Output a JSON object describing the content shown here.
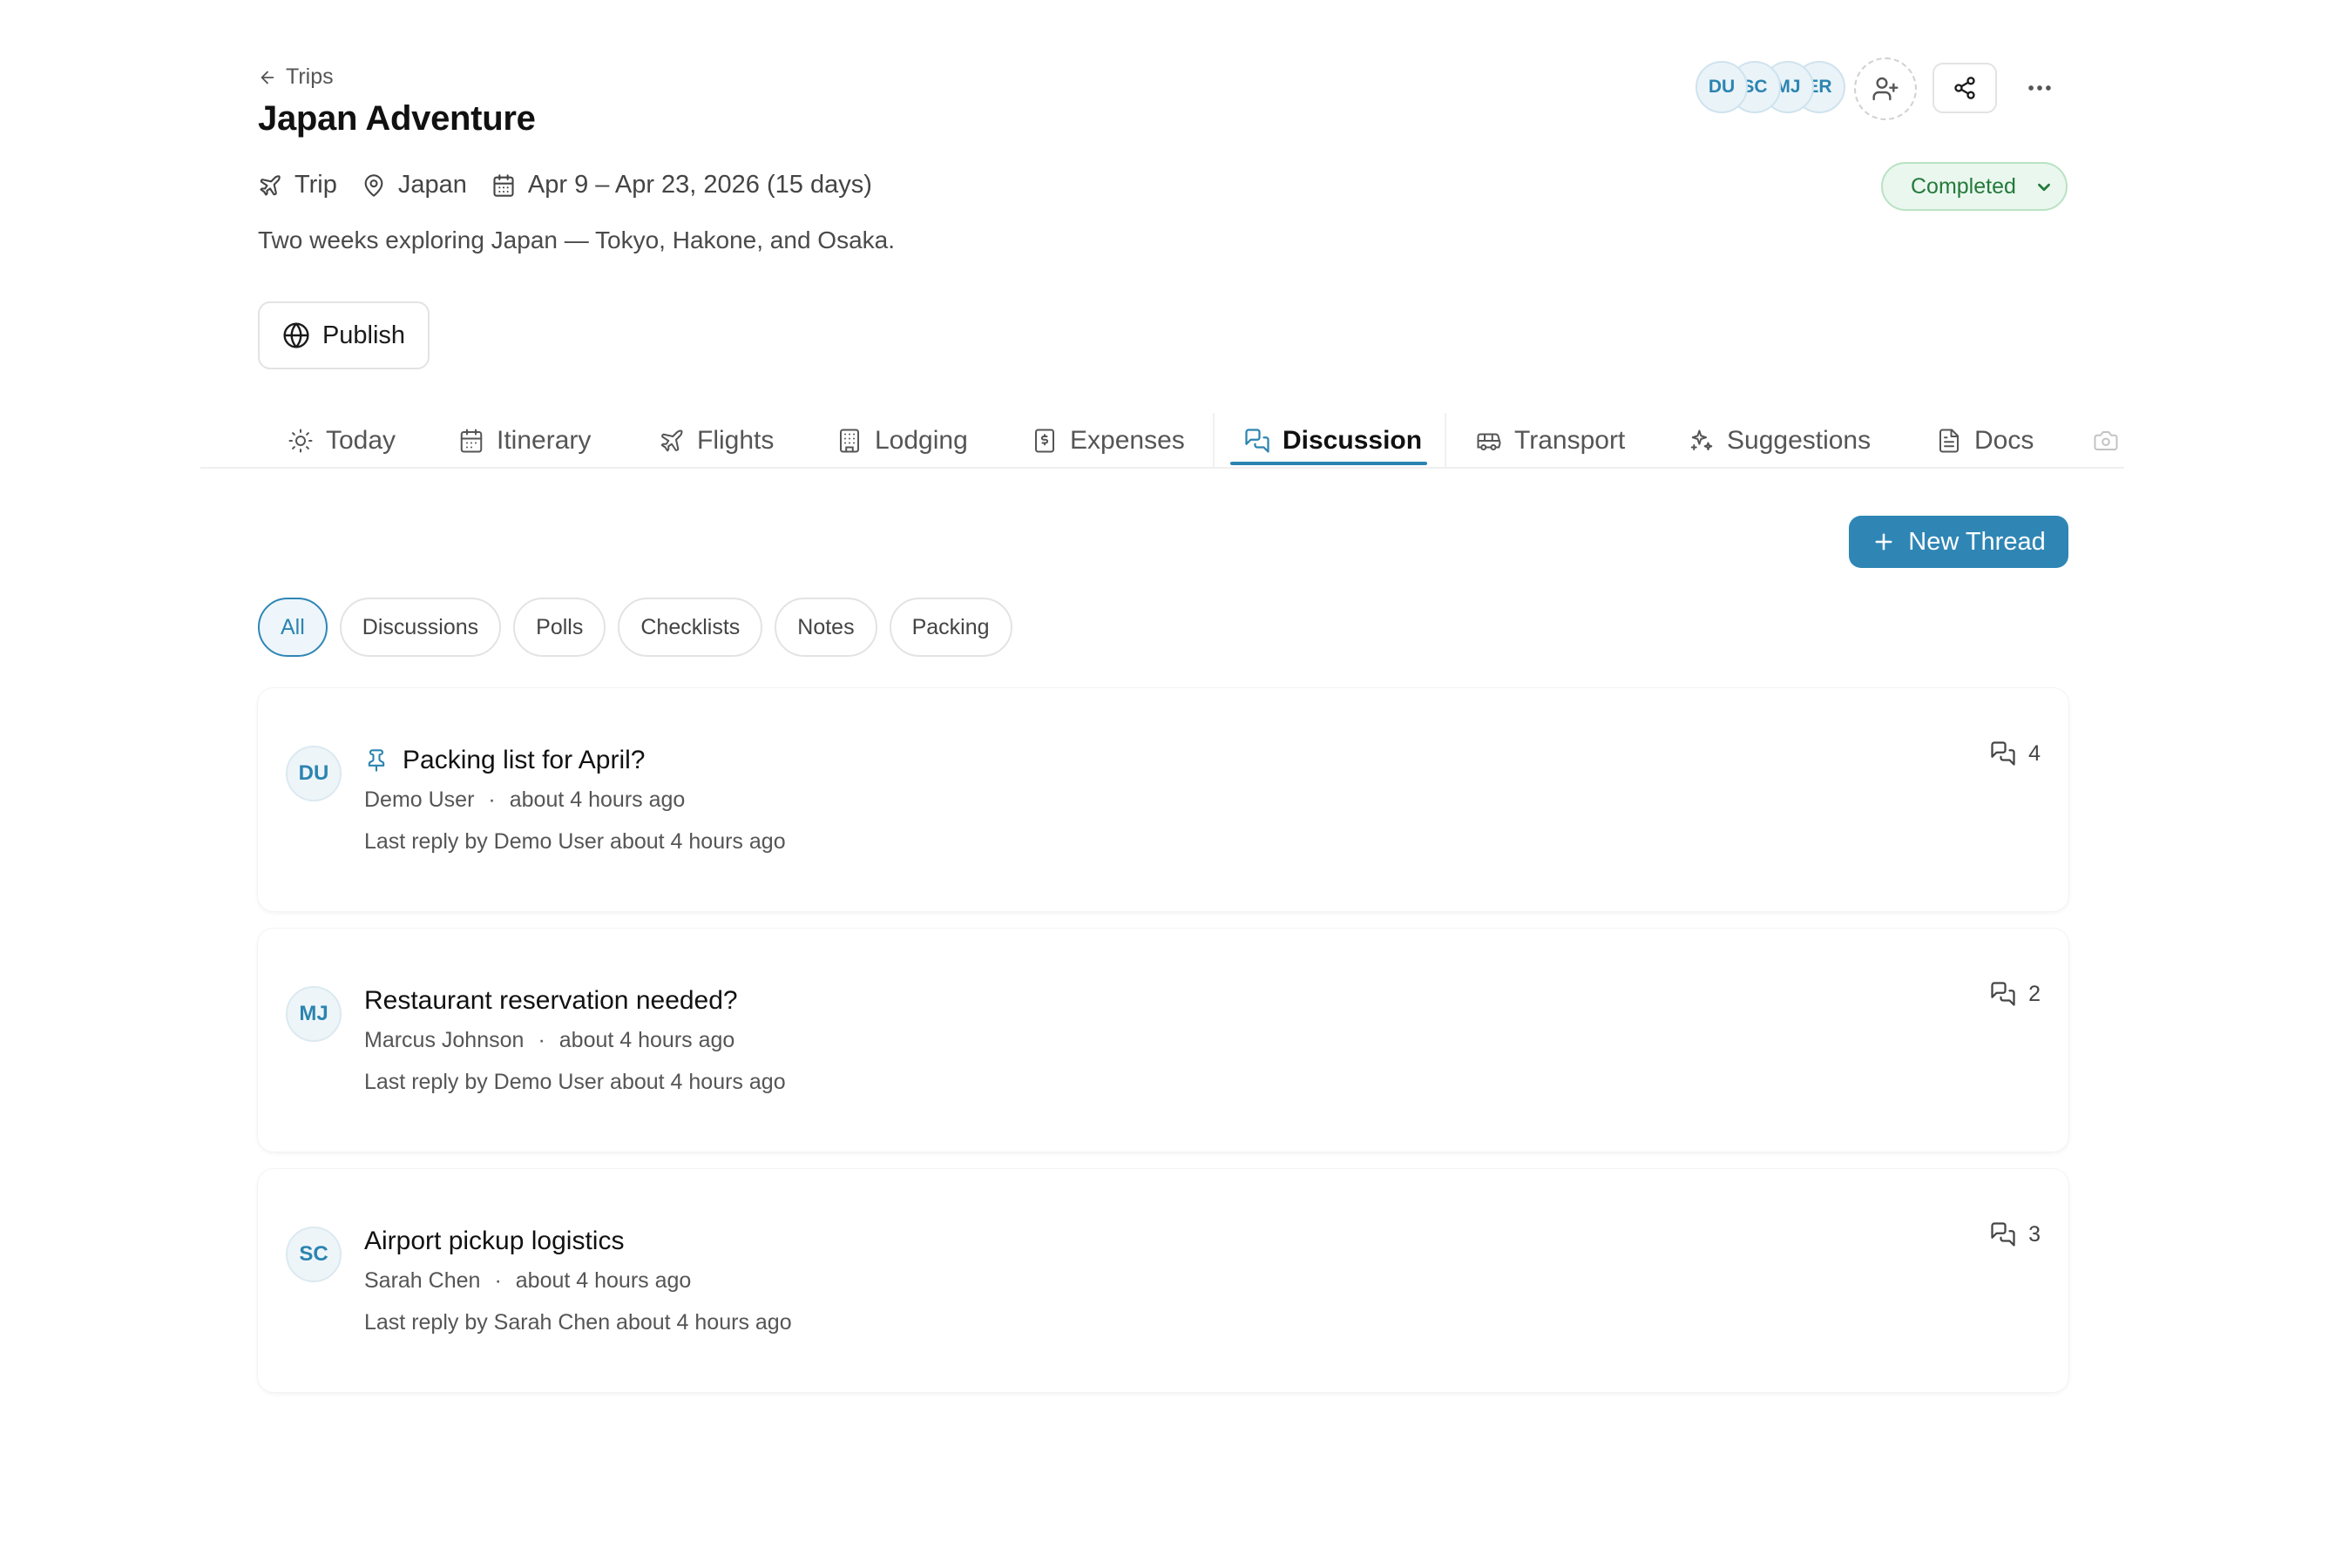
{
  "header": {
    "back_label": "Trips",
    "title": "Japan Adventure",
    "type": "Trip",
    "location": "Japan",
    "dates": "Apr 9 – Apr 23, 2026 (15 days)",
    "description": "Two weeks exploring Japan — Tokyo, Hakone, and Osaka.",
    "publish_label": "Publish",
    "status": "Completed"
  },
  "members": [
    "DU",
    "SC",
    "MJ",
    "ER"
  ],
  "tabs": [
    {
      "label": "Today",
      "icon": "sun-icon"
    },
    {
      "label": "Itinerary",
      "icon": "calendar-icon"
    },
    {
      "label": "Flights",
      "icon": "plane-icon"
    },
    {
      "label": "Lodging",
      "icon": "building-icon"
    },
    {
      "label": "Expenses",
      "icon": "receipt-icon"
    },
    {
      "label": "Discussion",
      "icon": "chat-icon",
      "active": true
    },
    {
      "label": "Transport",
      "icon": "bus-icon"
    },
    {
      "label": "Suggestions",
      "icon": "sparkles-icon"
    },
    {
      "label": "Docs",
      "icon": "document-icon"
    }
  ],
  "new_thread_label": "New Thread",
  "filters": [
    "All",
    "Discussions",
    "Polls",
    "Checklists",
    "Notes",
    "Packing"
  ],
  "threads": [
    {
      "initials": "DU",
      "title": "Packing list for April?",
      "pinned": true,
      "author": "Demo User",
      "time": "about 4 hours ago",
      "last_reply": "Last reply by Demo User about 4 hours ago",
      "count": "4"
    },
    {
      "initials": "MJ",
      "title": "Restaurant reservation needed?",
      "pinned": false,
      "author": "Marcus Johnson",
      "time": "about 4 hours ago",
      "last_reply": "Last reply by Demo User about 4 hours ago",
      "count": "2"
    },
    {
      "initials": "SC",
      "title": "Airport pickup logistics",
      "pinned": false,
      "author": "Sarah Chen",
      "time": "about 4 hours ago",
      "last_reply": "Last reply by Sarah Chen about 4 hours ago",
      "count": "3"
    }
  ],
  "colors": {
    "accent": "#2f86b5",
    "status_bg": "#eaf7ee",
    "status_text": "#237a3b"
  }
}
